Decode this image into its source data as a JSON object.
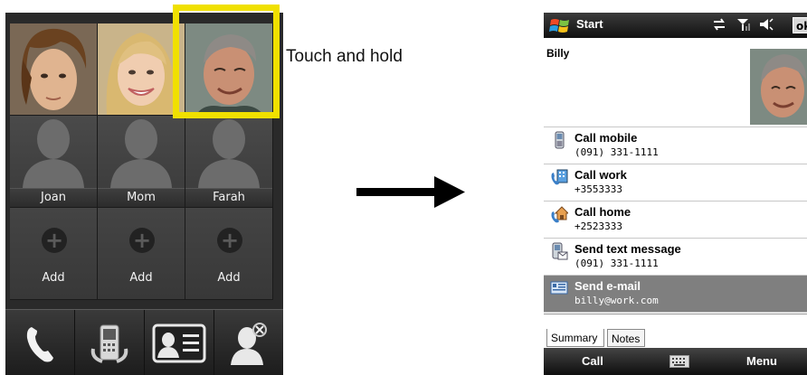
{
  "instruction": "Touch and hold",
  "left_phone": {
    "favorites": [
      {
        "type": "photo",
        "person": "young-man"
      },
      {
        "type": "photo",
        "person": "woman"
      },
      {
        "type": "photo",
        "person": "older-man",
        "highlighted": true
      },
      {
        "type": "contact",
        "label": "Joan"
      },
      {
        "type": "contact",
        "label": "Mom"
      },
      {
        "type": "contact",
        "label": "Farah"
      },
      {
        "type": "add",
        "label": "Add"
      },
      {
        "type": "add",
        "label": "Add"
      },
      {
        "type": "add",
        "label": "Add"
      }
    ],
    "bottom_bar": [
      "phone-icon",
      "call-history-icon",
      "contact-card-icon",
      "remove-contact-icon"
    ]
  },
  "right_phone": {
    "title": "Start",
    "ok_label": "ok",
    "status_icons": [
      "sync-icon",
      "signal-icon",
      "volume-icon"
    ],
    "contact_name": "Billy",
    "actions": [
      {
        "title": "Call mobile",
        "detail": "(091) 331-1111",
        "icon": "mobile-phone-icon"
      },
      {
        "title": "Call work",
        "detail": "+3553333",
        "icon": "work-phone-icon"
      },
      {
        "title": "Call home",
        "detail": "+2523333",
        "icon": "home-phone-icon"
      },
      {
        "title": "Send text message",
        "detail": "(091) 331-1111",
        "icon": "text-message-icon"
      },
      {
        "title": "Send e-mail",
        "detail": "billy@work.com",
        "icon": "email-icon",
        "selected": true
      }
    ],
    "tabs": [
      "Summary",
      "Notes"
    ],
    "softkeys": {
      "left": "Call",
      "right": "Menu"
    }
  }
}
